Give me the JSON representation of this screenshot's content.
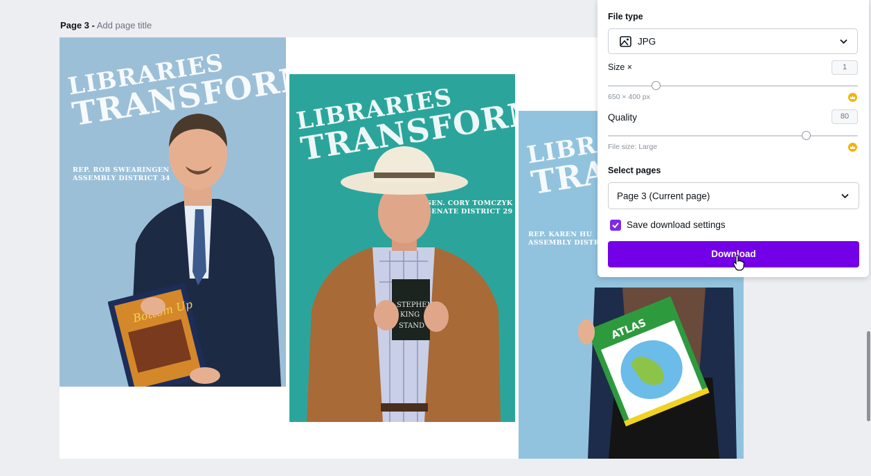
{
  "editor": {
    "page_label": "Page 3 -",
    "page_title_placeholder": "Add page title"
  },
  "posters": [
    {
      "headline_line1": "LIBRARIES",
      "headline_line2": "TRANSFORM!",
      "caption_line1": "REP. ROB SWEARINGEN",
      "caption_line2": "ASSEMBLY DISTRICT 34",
      "background": "#9cbfd8"
    },
    {
      "headline_line1": "LIBRARIES",
      "headline_line2": "TRANSFORM!",
      "caption_line1": "SEN. CORY TOMCZYK",
      "caption_line2": "SENATE DISTRICT 29",
      "background": "#2ba59c"
    },
    {
      "headline_line1": "LIBRAR",
      "headline_line2": "TRAN",
      "caption_line1": "REP. KAREN HU",
      "caption_line2": "ASSEMBLY DISTRICT",
      "background": "#92c3de"
    }
  ],
  "download_panel": {
    "file_type_label": "File type",
    "file_type_value": "JPG",
    "file_type_icon": "image-icon",
    "size_label": "Size ×",
    "size_value": "1",
    "size_dimensions": "650 × 400 px",
    "quality_label": "Quality",
    "quality_value": "80",
    "file_size_text": "File size: Large",
    "select_pages_label": "Select pages",
    "select_pages_value": "Page 3 (Current page)",
    "save_settings_label": "Save download settings",
    "save_settings_checked": true,
    "download_button": "Download",
    "premium_icon": "crown-icon",
    "accent": "#7300e6"
  }
}
